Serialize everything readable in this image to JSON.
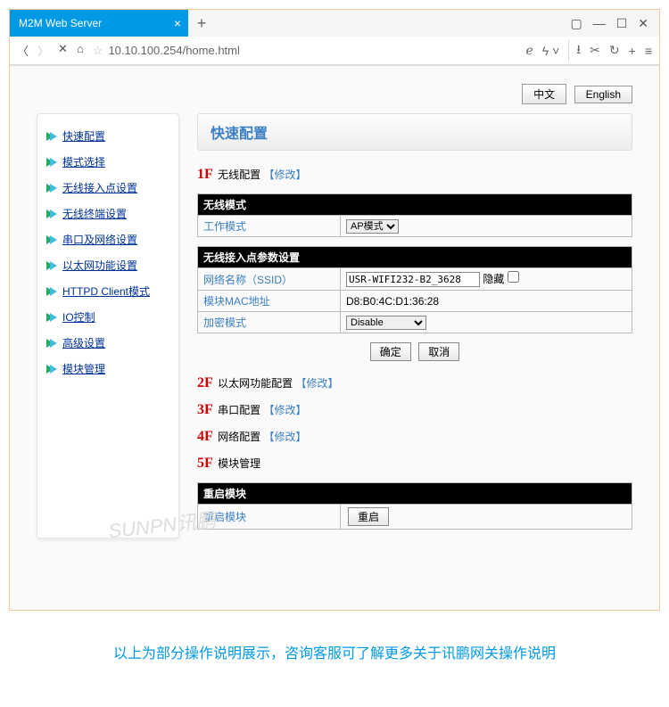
{
  "browser": {
    "tab_title": "M2M Web Server",
    "url": "10.10.100.254/home.html"
  },
  "lang": {
    "zh": "中文",
    "en": "English"
  },
  "sidebar": {
    "items": [
      {
        "label": "快速配置"
      },
      {
        "label": "模式选择"
      },
      {
        "label": "无线接入点设置"
      },
      {
        "label": "无线终端设置"
      },
      {
        "label": "串口及网络设置"
      },
      {
        "label": "以太网功能设置"
      },
      {
        "label": "HTTPD Client模式"
      },
      {
        "label": "IO控制"
      },
      {
        "label": "高级设置"
      },
      {
        "label": "模块管理"
      }
    ]
  },
  "page": {
    "title": "快速配置",
    "steps": {
      "s1": {
        "num": "1F",
        "name": "无线配置",
        "edit": "【修改】"
      },
      "s2": {
        "num": "2F",
        "name": "以太网功能配置",
        "edit": "【修改】"
      },
      "s3": {
        "num": "3F",
        "name": "串口配置",
        "edit": "【修改】"
      },
      "s4": {
        "num": "4F",
        "name": "网络配置",
        "edit": "【修改】"
      },
      "s5": {
        "num": "5F",
        "name": "模块管理"
      }
    },
    "sections": {
      "wireless_mode": {
        "header": "无线模式",
        "work_mode_label": "工作模式",
        "work_mode_value": "AP模式"
      },
      "ap_params": {
        "header": "无线接入点参数设置",
        "ssid_label": "网络名称（SSID）",
        "ssid_value": "USR-WIFI232-B2_3628",
        "hide_label": "隐藏",
        "mac_label": "模块MAC地址",
        "mac_value": "D8:B0:4C:D1:36:28",
        "enc_label": "加密模式",
        "enc_value": "Disable"
      },
      "reboot": {
        "header": "重启模块",
        "row_label": "重启模块",
        "btn": "重启"
      }
    },
    "buttons": {
      "ok": "确定",
      "cancel": "取消"
    }
  },
  "watermark": "SUNPN讯鹏",
  "caption": "以上为部分操作说明展示，咨询客服可了解更多关于讯鹏网关操作说明"
}
